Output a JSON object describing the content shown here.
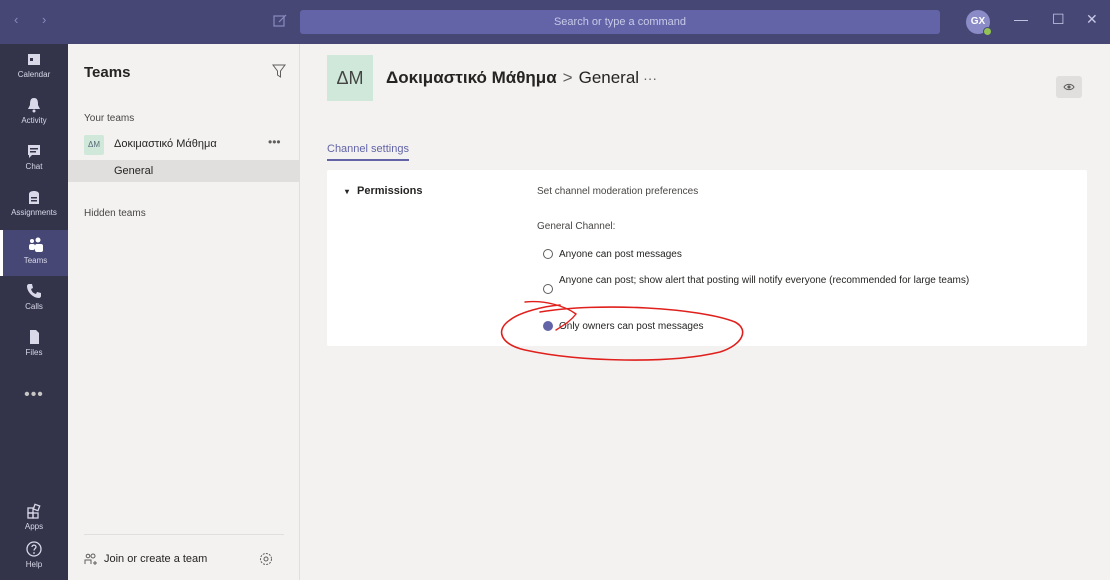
{
  "titlebar": {
    "search_placeholder": "Search or type a command",
    "avatar_initials": "GX",
    "minimize": "—",
    "maximize": "☐",
    "close": "✕",
    "nav": "‹ ›"
  },
  "rail": {
    "items": [
      {
        "label": "Calendar",
        "icon": "calendar-icon"
      },
      {
        "label": "Activity",
        "icon": "bell-icon"
      },
      {
        "label": "Chat",
        "icon": "chat-icon"
      },
      {
        "label": "Assignments",
        "icon": "assignments-icon"
      },
      {
        "label": "Teams",
        "icon": "teams-icon"
      },
      {
        "label": "Calls",
        "icon": "phone-icon"
      },
      {
        "label": "Files",
        "icon": "file-icon"
      }
    ],
    "more": "•••",
    "apps_label": "Apps",
    "help_label": "Help"
  },
  "panel": {
    "title": "Teams",
    "your_teams": "Your teams",
    "team_badge": "ΔΜ",
    "team_name": "Δοκιμαστικό Μάθημα",
    "team_more": "•••",
    "channel": "General",
    "hidden_teams": "Hidden teams",
    "join": "Join or create a team"
  },
  "main": {
    "badge": "ΔΜ",
    "team": "Δοκιμαστικό Μάθημα",
    "separator": ">",
    "channel": "General",
    "more": "···",
    "tab": "Channel settings",
    "permissions": {
      "caret": "▾",
      "title": "Permissions",
      "description": "Set channel moderation preferences",
      "group_label": "General Channel:",
      "options": [
        {
          "label": "Anyone can post messages",
          "checked": false
        },
        {
          "label": "Anyone can post; show alert that posting will notify everyone (recommended for large teams)",
          "checked": false
        },
        {
          "label": "Only owners can post messages",
          "checked": true
        }
      ]
    }
  },
  "colors": {
    "accent": "#6264a7",
    "titlebar": "#464775",
    "rail": "#33344a",
    "annotation": "#e0201c"
  }
}
